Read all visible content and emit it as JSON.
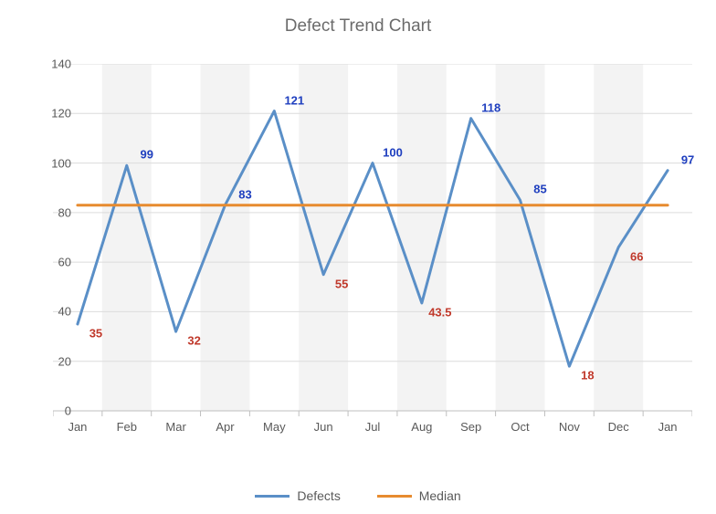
{
  "chart_data": {
    "type": "line",
    "title": "Defect Trend Chart",
    "categories": [
      "Jan",
      "Feb",
      "Mar",
      "Apr",
      "May",
      "Jun",
      "Jul",
      "Aug",
      "Sep",
      "Oct",
      "Nov",
      "Dec",
      "Jan"
    ],
    "series": [
      {
        "name": "Defects",
        "color": "#5A8FC7",
        "values": [
          35,
          99,
          32,
          83,
          121,
          55,
          100,
          43.5,
          118,
          85,
          18,
          66,
          97
        ]
      },
      {
        "name": "Median",
        "color": "#E78B2F",
        "values": [
          83,
          83,
          83,
          83,
          83,
          83,
          83,
          83,
          83,
          83,
          83,
          83,
          83
        ]
      }
    ],
    "yticks": [
      0,
      20,
      40,
      60,
      80,
      100,
      120,
      140
    ],
    "ylim": [
      0,
      140
    ],
    "xlabel": "",
    "ylabel": "",
    "legend_position": "bottom",
    "grid": true,
    "data_labels": [
      {
        "text": "35",
        "x": 0,
        "y": 35,
        "color": "below"
      },
      {
        "text": "99",
        "x": 1,
        "y": 99,
        "color": "above"
      },
      {
        "text": "32",
        "x": 2,
        "y": 32,
        "color": "below"
      },
      {
        "text": "83",
        "x": 3,
        "y": 83,
        "color": "above"
      },
      {
        "text": "121",
        "x": 4,
        "y": 121,
        "color": "above"
      },
      {
        "text": "55",
        "x": 5,
        "y": 55,
        "color": "below"
      },
      {
        "text": "100",
        "x": 6,
        "y": 100,
        "color": "above"
      },
      {
        "text": "43.5",
        "x": 7,
        "y": 43.5,
        "color": "below"
      },
      {
        "text": "118",
        "x": 8,
        "y": 118,
        "color": "above"
      },
      {
        "text": "85",
        "x": 9,
        "y": 85,
        "color": "above"
      },
      {
        "text": "18",
        "x": 10,
        "y": 18,
        "color": "below"
      },
      {
        "text": "66",
        "x": 11,
        "y": 66,
        "color": "below"
      },
      {
        "text": "97",
        "x": 12,
        "y": 97,
        "color": "above"
      }
    ],
    "label_colors": {
      "above": "#1F3FBF",
      "below": "#C0392B"
    }
  },
  "legend": {
    "defects": "Defects",
    "median": "Median"
  }
}
